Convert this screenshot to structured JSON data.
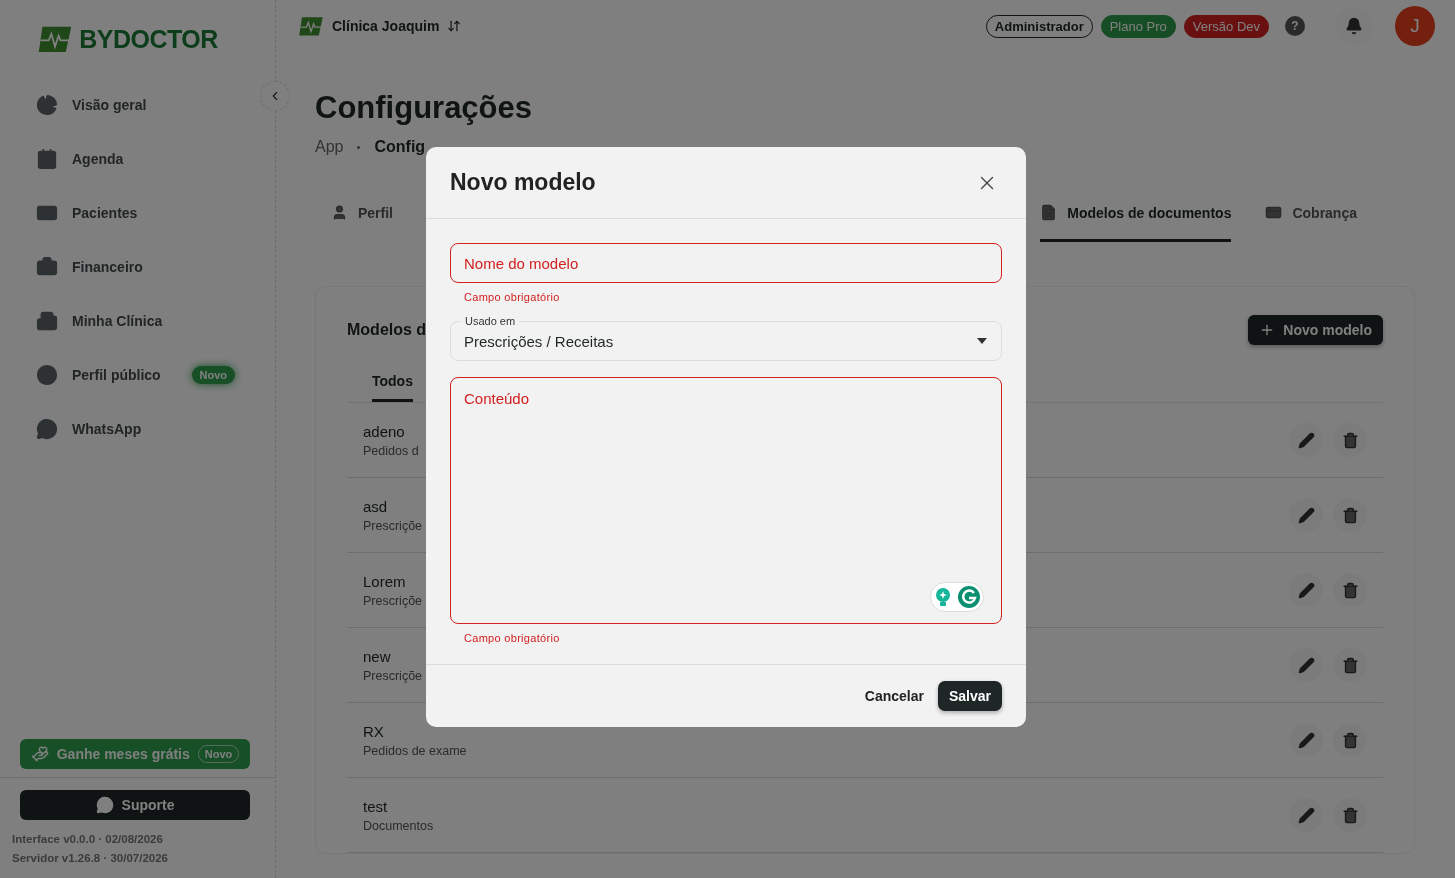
{
  "sidebar": {
    "logo": "BYDOCTOR",
    "items": [
      {
        "label": "Visão geral"
      },
      {
        "label": "Agenda"
      },
      {
        "label": "Pacientes"
      },
      {
        "label": "Financeiro"
      },
      {
        "label": "Minha Clínica"
      },
      {
        "label": "Perfil público",
        "badge": "Novo"
      },
      {
        "label": "WhatsApp"
      }
    ],
    "promo": {
      "label": "Ganhe meses grátis",
      "badge": "Novo"
    },
    "support": "Suporte",
    "versions": [
      "Interface v0.0.0 · 02/08/2026",
      "Servidor v1.26.8 · 30/07/2026"
    ]
  },
  "topbar": {
    "clinic": "Clínica Joaquim",
    "badges": [
      {
        "label": "Administrador",
        "kind": "outline"
      },
      {
        "label": "Plano Pro",
        "kind": "success"
      },
      {
        "label": "Versão Dev",
        "kind": "danger"
      }
    ],
    "help": "?",
    "avatar": "J"
  },
  "page": {
    "title": "Configurações",
    "breadcrumb": [
      "App",
      "Config"
    ],
    "tabs": [
      {
        "label": "Perfil",
        "selected": false
      },
      {
        "label": "Modelos de documentos",
        "selected": true
      },
      {
        "label": "Cobrança",
        "selected": false
      }
    ]
  },
  "card": {
    "title": "Modelos d",
    "new_button": "Novo modelo",
    "filters": [
      {
        "label": "Todos",
        "selected": true
      }
    ],
    "rows": [
      {
        "name": "adeno",
        "type": "Pedidos d"
      },
      {
        "name": "asd",
        "type": "Prescriçõe"
      },
      {
        "name": "Lorem",
        "type": "Prescriçõe"
      },
      {
        "name": "new",
        "type": "Prescriçõe"
      },
      {
        "name": "RX",
        "type": "Pedidos de exame"
      },
      {
        "name": "test",
        "type": "Documentos"
      }
    ]
  },
  "modal": {
    "title": "Novo modelo",
    "name_field": {
      "placeholder": "Nome do modelo",
      "invalid": true,
      "error": "Campo obrigatório"
    },
    "usage_select": {
      "label": "Usado em",
      "value": "Prescrições / Receitas"
    },
    "content_field": {
      "placeholder": "Conteúdo",
      "invalid": true,
      "error": "Campo obrigatório"
    },
    "cancel": "Cancelar",
    "save": "Salvar"
  }
}
